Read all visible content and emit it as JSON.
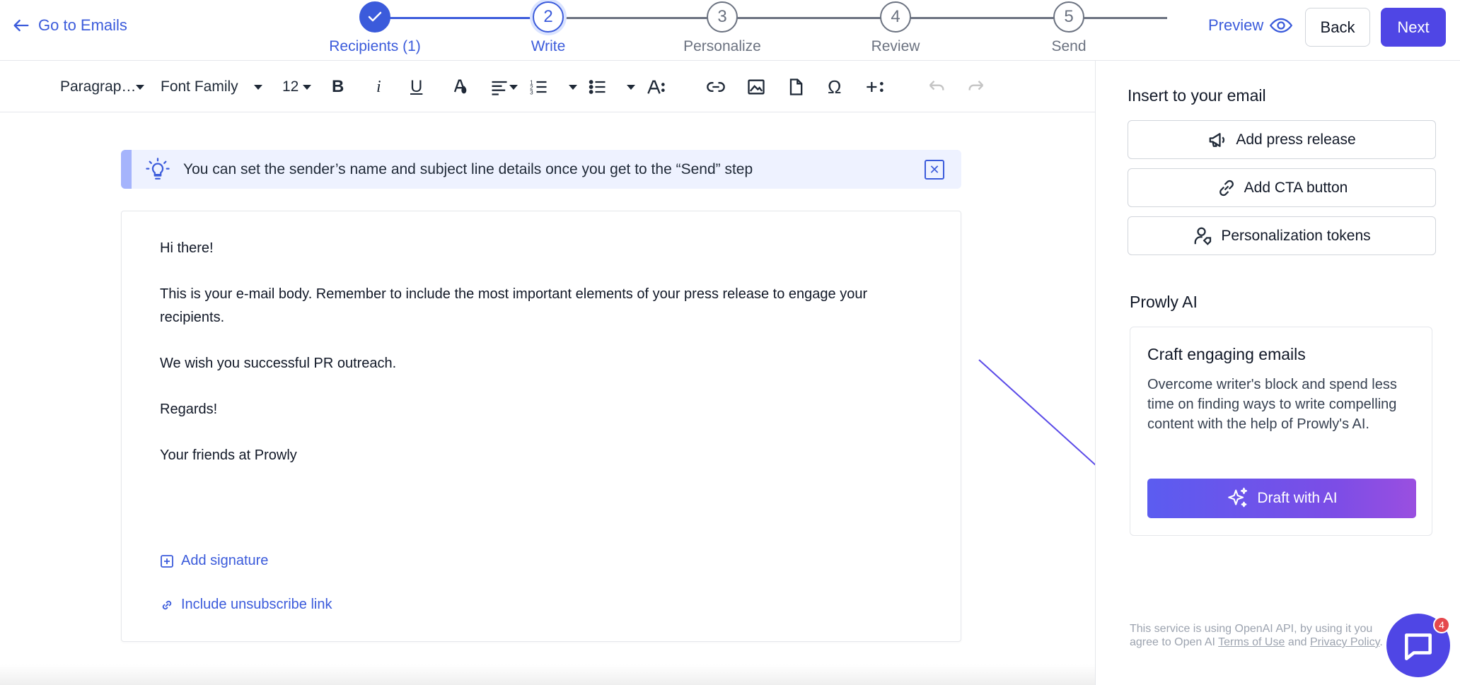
{
  "header": {
    "back_link": "Go to Emails",
    "preview": "Preview",
    "back_button": "Back",
    "next_button": "Next"
  },
  "stepper": {
    "steps": [
      {
        "number": "",
        "label": "Recipients (1)",
        "state": "done"
      },
      {
        "number": "2",
        "label": "Write",
        "state": "active"
      },
      {
        "number": "3",
        "label": "Personalize",
        "state": "upcoming"
      },
      {
        "number": "4",
        "label": "Review",
        "state": "upcoming"
      },
      {
        "number": "5",
        "label": "Send",
        "state": "upcoming"
      }
    ]
  },
  "toolbar": {
    "paragraph": "Paragrap…",
    "font_family": "Font Family",
    "font_size": "12"
  },
  "banner": {
    "text": "You can set the sender’s name and subject line details once you get to the “Send” step"
  },
  "editor": {
    "paragraphs": [
      "Hi there!",
      "This is your e-mail body. Remember to include the most important elements of your press release to engage your recipients.",
      "We wish you successful PR outreach.",
      "Regards!",
      "Your friends at Prowly"
    ],
    "add_signature": "Add signature",
    "unsubscribe": "Include unsubscribe link"
  },
  "right_panel": {
    "insert_title": "Insert to your email",
    "insert_buttons": [
      "Add press release",
      "Add CTA button",
      "Personalization tokens"
    ],
    "ai_title": "Prowly AI",
    "ai_card_title": "Craft engaging emails",
    "ai_card_desc": "Overcome writer's block and spend less time on finding ways to write compelling content with the help of Prowly's AI.",
    "draft_button": "Draft with AI",
    "footnote_prefix": "This service is using OpenAI API, by using it you agree to Open AI ",
    "footnote_terms": "Terms of Use",
    "footnote_and": " and ",
    "footnote_privacy": "Privacy Policy",
    "footnote_end": "."
  },
  "chat": {
    "badge": "4"
  },
  "colors": {
    "accent": "#3b5bdb",
    "primary_button": "#4f46e5",
    "banner_bg": "#eef2ff"
  }
}
